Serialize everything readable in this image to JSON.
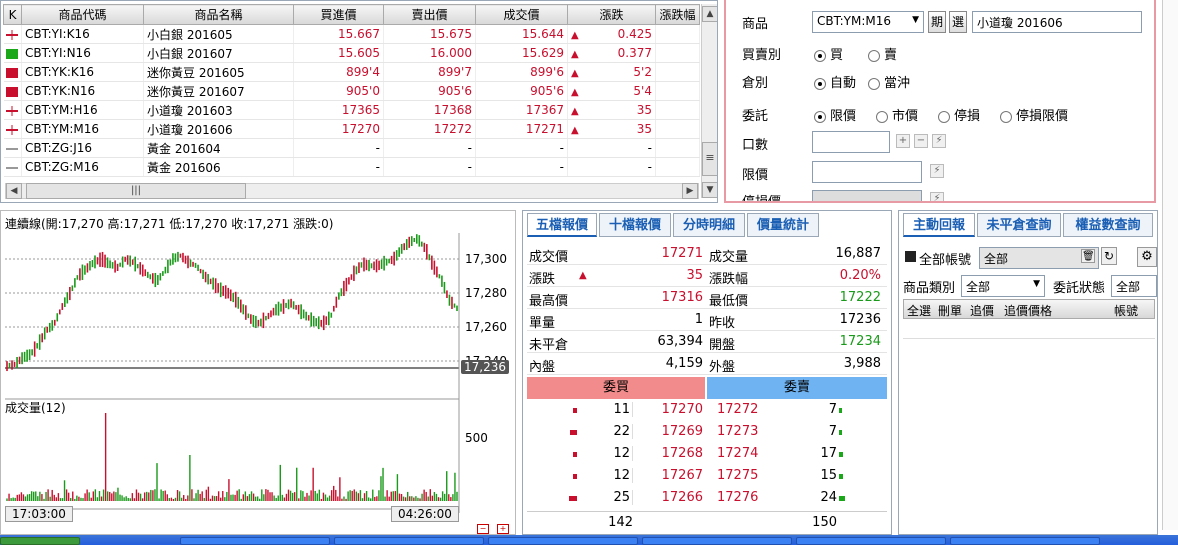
{
  "quote": {
    "headers": [
      "K",
      "商品代碼",
      "商品名稱",
      "買進價",
      "賣出價",
      "成交價",
      "漲跌",
      "漲跌幅"
    ],
    "rows": [
      {
        "icon": "cross-red",
        "code": "CBT:YI:K16",
        "name": "小白銀 201605",
        "bid": "15.667",
        "ask": "15.675",
        "last": "15.644",
        "dir": "▲",
        "chg": "0.425"
      },
      {
        "icon": "square-green",
        "code": "CBT:YI:N16",
        "name": "小白銀 201607",
        "bid": "15.605",
        "ask": "16.000",
        "last": "15.629",
        "dir": "▲",
        "chg": "0.377"
      },
      {
        "icon": "square-red",
        "code": "CBT:YK:K16",
        "name": "迷你黃豆 201605",
        "bid": "899'4",
        "ask": "899'7",
        "last": "899'6",
        "dir": "▲",
        "chg": "5'2"
      },
      {
        "icon": "square-red",
        "code": "CBT:YK:N16",
        "name": "迷你黃豆 201607",
        "bid": "905'0",
        "ask": "905'6",
        "last": "905'6",
        "dir": "▲",
        "chg": "5'4"
      },
      {
        "icon": "cross-red",
        "code": "CBT:YM:H16",
        "name": "小道瓊 201603",
        "bid": "17365",
        "ask": "17368",
        "last": "17367",
        "dir": "▲",
        "chg": "35"
      },
      {
        "icon": "cross-red",
        "code": "CBT:YM:M16",
        "name": "小道瓊 201606",
        "bid": "17270",
        "ask": "17272",
        "last": "17271",
        "dir": "▲",
        "chg": "35"
      },
      {
        "icon": "dash",
        "code": "CBT:ZG:J16",
        "name": "黃金 201604",
        "bid": "-",
        "ask": "-",
        "last": "-",
        "dir": "",
        "chg": "-"
      },
      {
        "icon": "dash",
        "code": "CBT:ZG:M16",
        "name": "黃金 201606",
        "bid": "-",
        "ask": "-",
        "last": "-",
        "dir": "",
        "chg": "-"
      }
    ]
  },
  "order": {
    "product_label": "商品",
    "product_select": "CBT:YM:M16",
    "btn_futures": "期",
    "btn_options": "選",
    "product_name": "小道瓊 201606",
    "side_label": "買賣別",
    "side_buy": "買",
    "side_sell": "賣",
    "pos_label": "倉別",
    "pos_auto": "自動",
    "pos_day": "當沖",
    "type_label": "委託",
    "type_limit": "限價",
    "type_market": "市價",
    "type_stop": "停損",
    "type_stoplimit": "停損限價",
    "qty_label": "口數",
    "price_label": "限價",
    "stop_label": "停損價"
  },
  "chart": {
    "title": "連續線(開:17,270 高:17,271 低:17,270 收:17,271 漲跌:0)",
    "volume_title": "成交量(12)",
    "y_ticks": [
      "17,300",
      "17,280",
      "17,260",
      "17,240"
    ],
    "current_price": "17,236",
    "vol_tick": "500",
    "time_start": "17:03:00",
    "time_end": "04:26:00"
  },
  "chart_data": {
    "type": "line",
    "title": "連續線(開:17,270 高:17,271 低:17,270 收:17,271 漲跌:0)",
    "ylim": [
      17232,
      17320
    ],
    "y_ticks": [
      17300,
      17280,
      17260,
      17240
    ],
    "x_range": [
      "17:03:00",
      "04:26:00"
    ],
    "series": [
      {
        "values": [
          17237,
          17238,
          17242,
          17244,
          17250,
          17258,
          17262,
          17272,
          17280,
          17290,
          17294,
          17298,
          17300,
          17297,
          17295,
          17300,
          17298,
          17294,
          17290,
          17287,
          17293,
          17300,
          17302,
          17298,
          17296,
          17290,
          17286,
          17282,
          17280,
          17276,
          17270,
          17264,
          17262,
          17266,
          17270,
          17272,
          17274,
          17270,
          17266,
          17263,
          17262,
          17266,
          17278,
          17285,
          17292,
          17297,
          17296,
          17296,
          17298,
          17300,
          17306,
          17310,
          17312,
          17306,
          17296,
          17288,
          17276,
          17271
        ]
      }
    ]
  },
  "five": {
    "tabs": [
      "五檔報價",
      "十檔報價",
      "分時明細",
      "價量統計"
    ],
    "rows": [
      {
        "l1": "成交價",
        "v1": "17271",
        "c1": "red",
        "l2": "成交量",
        "v2": "16,887",
        "c2": "black"
      },
      {
        "l1": "漲跌",
        "v1": "35",
        "c1": "red",
        "l2": "漲跌幅",
        "v2": "0.20%",
        "c2": "red"
      },
      {
        "l1": "最高價",
        "v1": "17316",
        "c1": "red",
        "l2": "最低價",
        "v2": "17222",
        "c2": "green"
      },
      {
        "l1": "單量",
        "v1": "1",
        "c1": "black",
        "l2": "昨收",
        "v2": "17236",
        "c2": "black"
      },
      {
        "l1": "未平倉",
        "v1": "63,394",
        "c1": "black",
        "l2": "開盤",
        "v2": "17234",
        "c2": "green"
      },
      {
        "l1": "內盤",
        "v1": "4,159",
        "c1": "black",
        "l2": "外盤",
        "v2": "3,988",
        "c2": "black"
      }
    ],
    "bid_head": "委買",
    "ask_head": "委賣",
    "book": [
      {
        "bq": "11",
        "bp": "17270",
        "ap": "17272",
        "aq": "7"
      },
      {
        "bq": "22",
        "bp": "17269",
        "ap": "17273",
        "aq": "7"
      },
      {
        "bq": "12",
        "bp": "17268",
        "ap": "17274",
        "aq": "17"
      },
      {
        "bq": "12",
        "bp": "17267",
        "ap": "17275",
        "aq": "15"
      },
      {
        "bq": "25",
        "bp": "17266",
        "ap": "17276",
        "aq": "24"
      }
    ],
    "bid_total": "142",
    "ask_total": "150"
  },
  "report": {
    "tabs": [
      "主動回報",
      "未平倉查詢",
      "權益數查詢"
    ],
    "all_accounts": "全部帳號",
    "account_select": "全部",
    "category_label": "商品類別",
    "category_value": "全部",
    "status_label": "委託狀態",
    "status_value": "全部",
    "cols": [
      "全選",
      "刪單",
      "追價",
      "追價價格",
      "帳號"
    ]
  }
}
